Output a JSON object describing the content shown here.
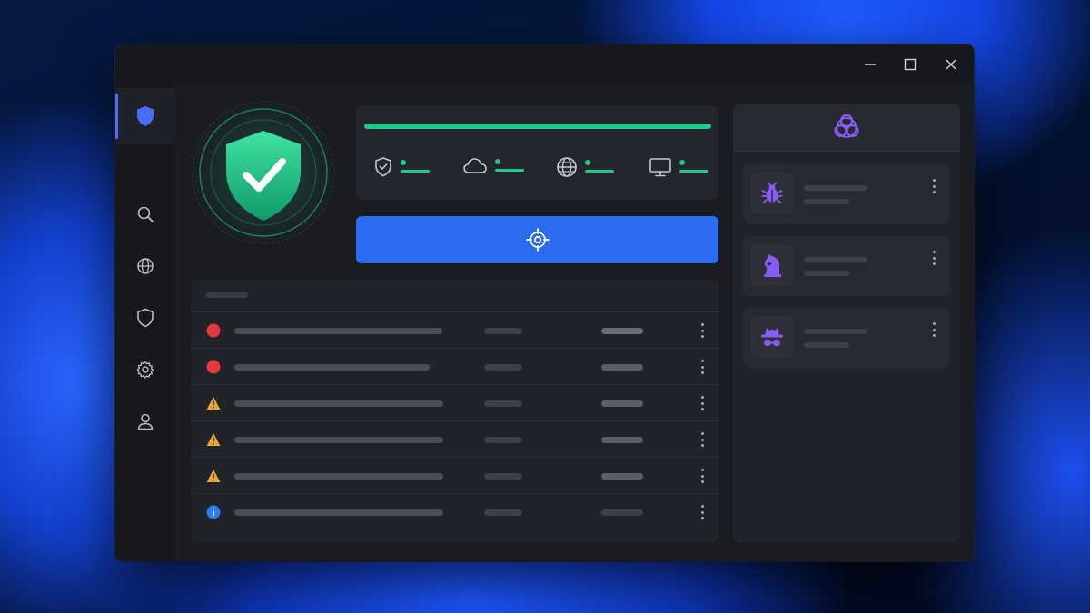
{
  "window": {
    "controls": [
      "minimize",
      "maximize",
      "close"
    ]
  },
  "sidebar": {
    "items": [
      {
        "icon": "shield-fill-icon",
        "active": true
      },
      {
        "icon": "search-icon",
        "active": false
      },
      {
        "icon": "globe-icon",
        "active": false
      },
      {
        "icon": "shield-outline-icon",
        "active": false
      },
      {
        "icon": "gear-icon",
        "active": false
      },
      {
        "icon": "user-icon",
        "active": false
      }
    ]
  },
  "status": {
    "protected": true,
    "progress": 1.0,
    "stats": [
      {
        "icon": "shield-check-icon"
      },
      {
        "icon": "cloud-icon"
      },
      {
        "icon": "globe-icon"
      },
      {
        "icon": "monitor-icon"
      }
    ]
  },
  "scan_button": {
    "icon": "target-icon"
  },
  "events": [
    {
      "severity": "critical"
    },
    {
      "severity": "critical"
    },
    {
      "severity": "warning"
    },
    {
      "severity": "warning"
    },
    {
      "severity": "warning"
    },
    {
      "severity": "info"
    }
  ],
  "threats_panel": {
    "header_icon": "biohazard-icon",
    "items": [
      {
        "icon": "bug-icon"
      },
      {
        "icon": "chess-knight-icon"
      },
      {
        "icon": "spy-icon"
      }
    ]
  },
  "colors": {
    "accent": "#4a6cff",
    "success": "#1fc98a",
    "scan_button": "#2b6cf0",
    "critical": "#e5393b",
    "warning": "#f0a52a",
    "info": "#2b7cf0",
    "threat_icon": "#8a5cf6"
  }
}
